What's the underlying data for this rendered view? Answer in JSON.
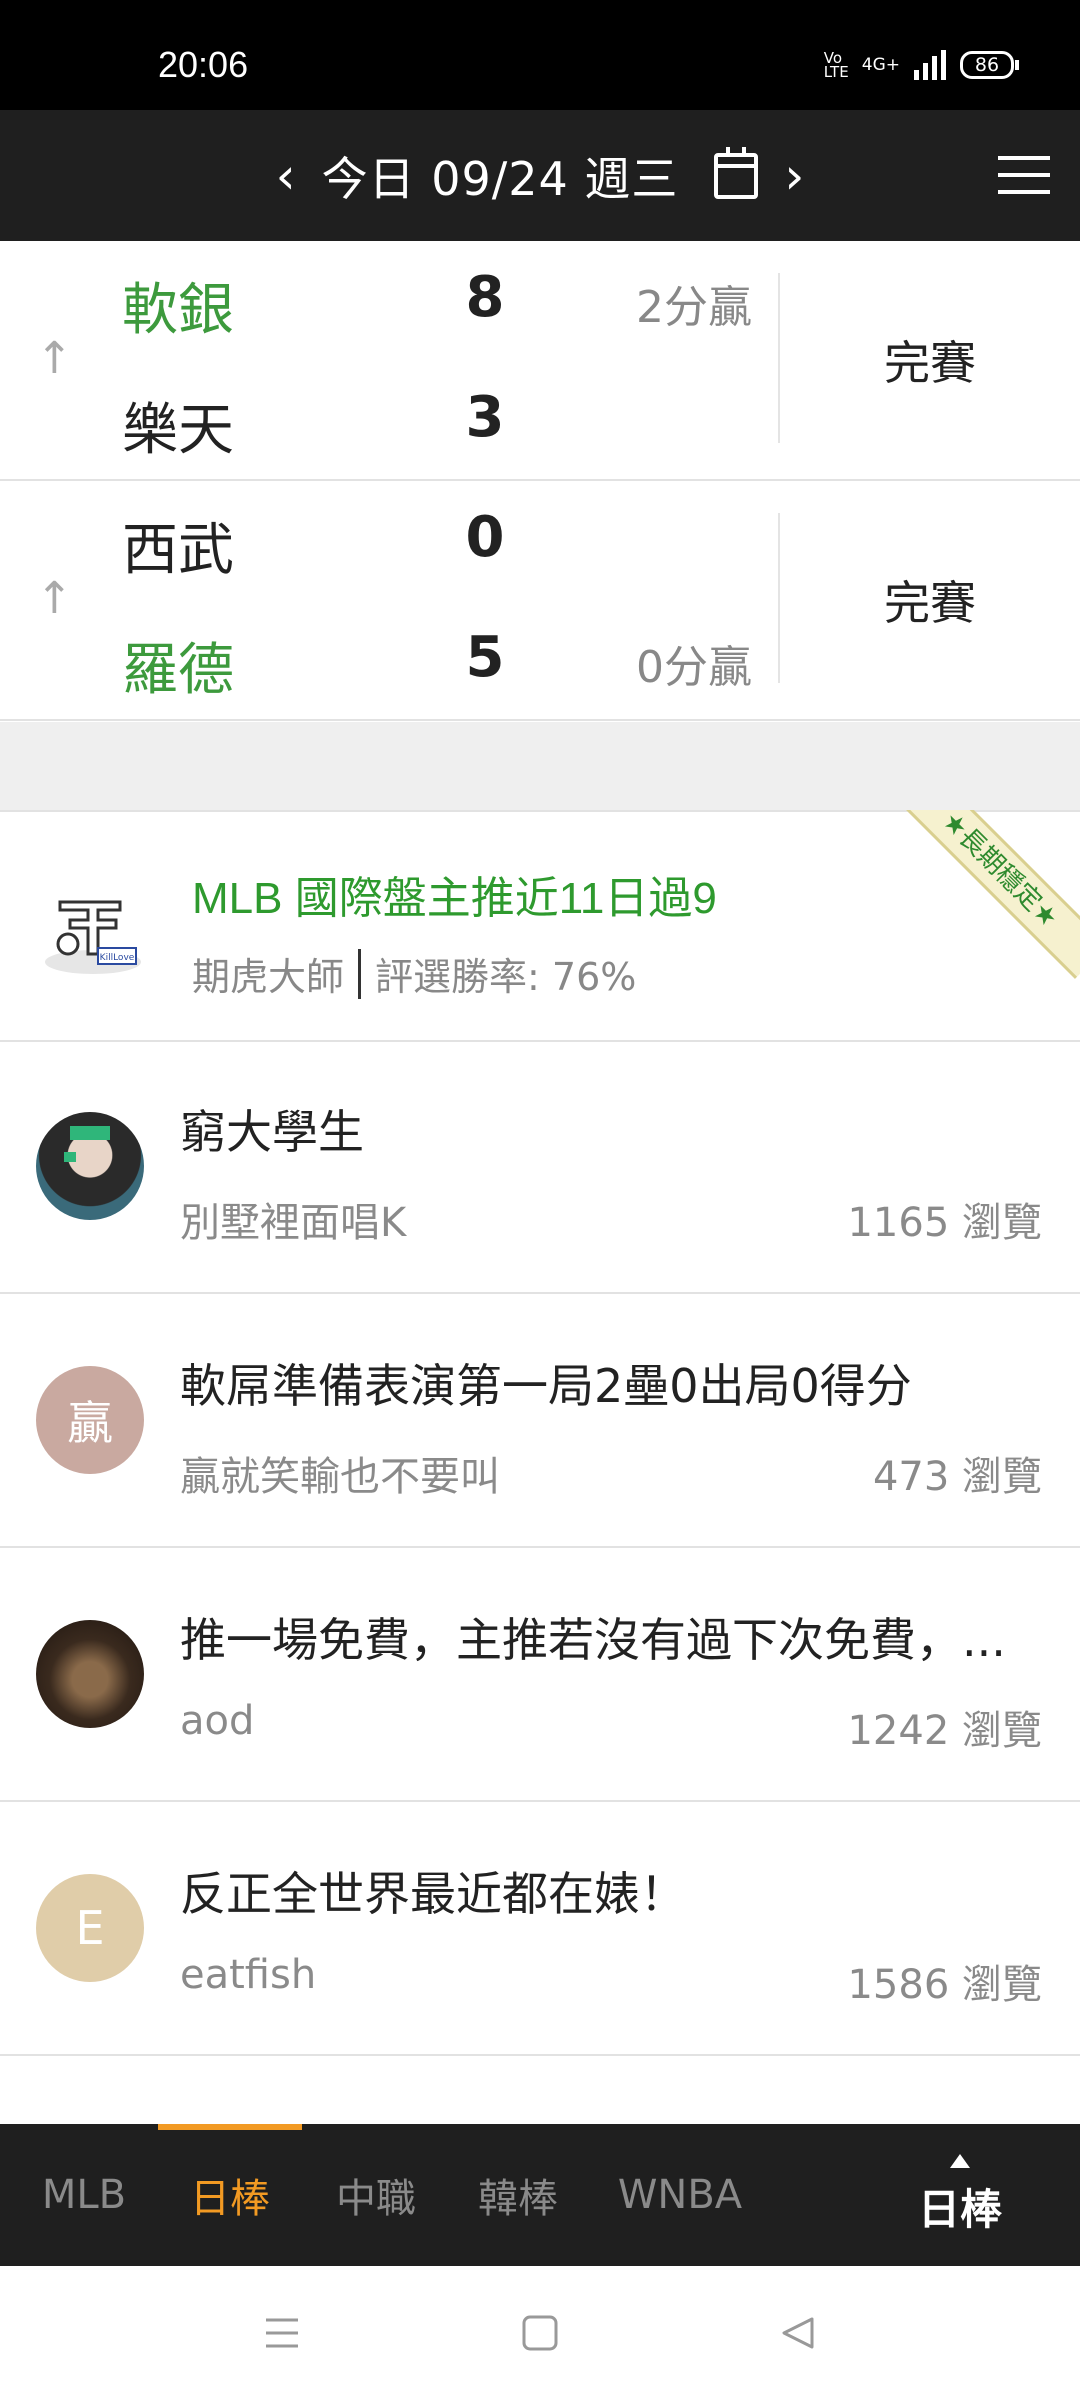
{
  "status_bar": {
    "time": "20:06",
    "network": "4G+",
    "volte": "Vo LTE",
    "battery": "86"
  },
  "header": {
    "date_label": "今日 09/24 週三",
    "prev_icon": "chevron-left-icon",
    "next_icon": "chevron-right-icon",
    "calendar_icon": "calendar-icon",
    "menu_icon": "hamburger-menu-icon"
  },
  "games": [
    {
      "teams": [
        {
          "name": "軟銀",
          "score": "8",
          "winner": true,
          "margin": "2分贏"
        },
        {
          "name": "樂天",
          "score": "3",
          "winner": false,
          "margin": ""
        }
      ],
      "status": "完賽"
    },
    {
      "teams": [
        {
          "name": "西武",
          "score": "0",
          "winner": false,
          "margin": ""
        },
        {
          "name": "羅德",
          "score": "5",
          "winner": true,
          "margin": "0分贏"
        }
      ],
      "status": "完賽"
    }
  ],
  "featured": {
    "title": "MLB 國際盤主推近11日過9",
    "author": "期虎大師",
    "win_rate": "評選勝率: 76%",
    "ribbon": "★長期穩定★",
    "logo_text": "KillLove"
  },
  "posts": [
    {
      "title": "窮大學生",
      "author": "別墅裡面唱K",
      "views": "1165 瀏覽",
      "avatar_letter": "",
      "avatar_color": "#3b4a3a"
    },
    {
      "title": "軟屌準備表演第一局2壘0出局0得分",
      "author": "贏就笑輸也不要叫",
      "views": "473 瀏覽",
      "avatar_letter": "贏",
      "avatar_color": "#c9a9a0"
    },
    {
      "title": "推一場免費，主推若沒有過下次免費，...",
      "author": "aod",
      "views": "1242 瀏覽",
      "avatar_letter": "",
      "avatar_color": "#4a3526"
    },
    {
      "title": "反正全世界最近都在婊！",
      "author": "eatfish",
      "views": "1586 瀏覽",
      "avatar_letter": "E",
      "avatar_color": "#e0cda9"
    }
  ],
  "tabs": [
    {
      "label": "MLB",
      "active": false
    },
    {
      "label": "日棒",
      "active": true
    },
    {
      "label": "中職",
      "active": false
    },
    {
      "label": "韓棒",
      "active": false
    },
    {
      "label": "WNBA",
      "active": false
    }
  ],
  "league_selector": "日棒",
  "colors": {
    "win_green": "#3d9a3d",
    "accent_orange": "#f29a23",
    "header_bg": "#1f1f1f"
  }
}
